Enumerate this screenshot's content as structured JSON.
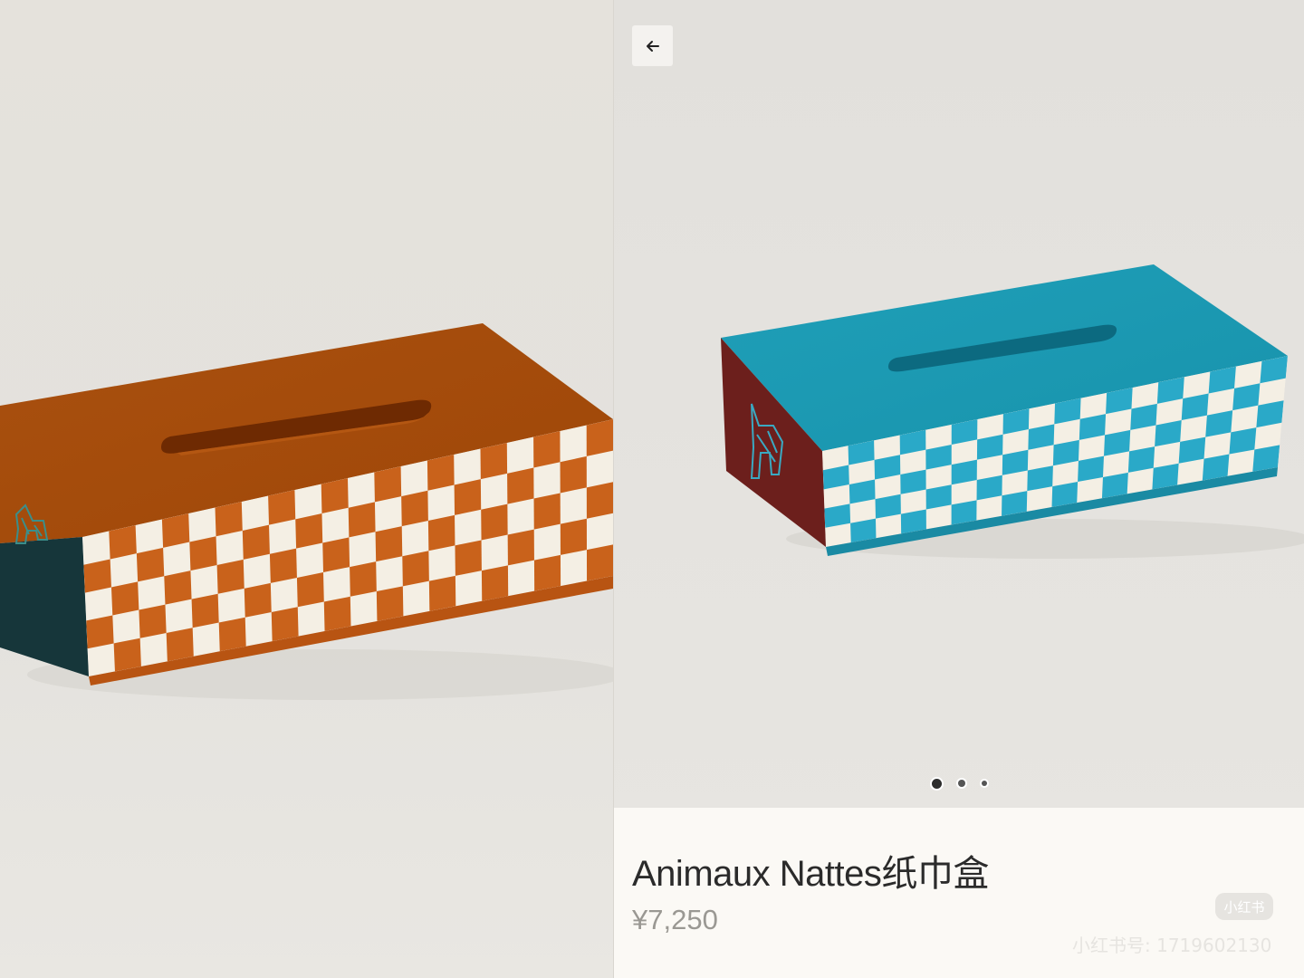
{
  "left_panel": {
    "product_image": "orange-checkered-tissue-box"
  },
  "right_panel": {
    "back_icon": "arrow-left-icon",
    "product_image": "teal-checkered-tissue-box",
    "carousel": {
      "count": 3,
      "active_index": 0
    },
    "product": {
      "title": "Animaux Nattes纸巾盒",
      "price": "¥7,250"
    },
    "watermark": {
      "logo": "小红书",
      "id_text": "小红书号: 1719602130"
    }
  },
  "colors": {
    "orange_top": "#a4490b",
    "orange_check": "#c9621b",
    "teal_top": "#1a9bb3",
    "teal_check": "#2aa9c8",
    "checker_white": "#f4efe4",
    "dark_teal_side": "#16363a",
    "burgundy_side": "#6c1f1c"
  }
}
